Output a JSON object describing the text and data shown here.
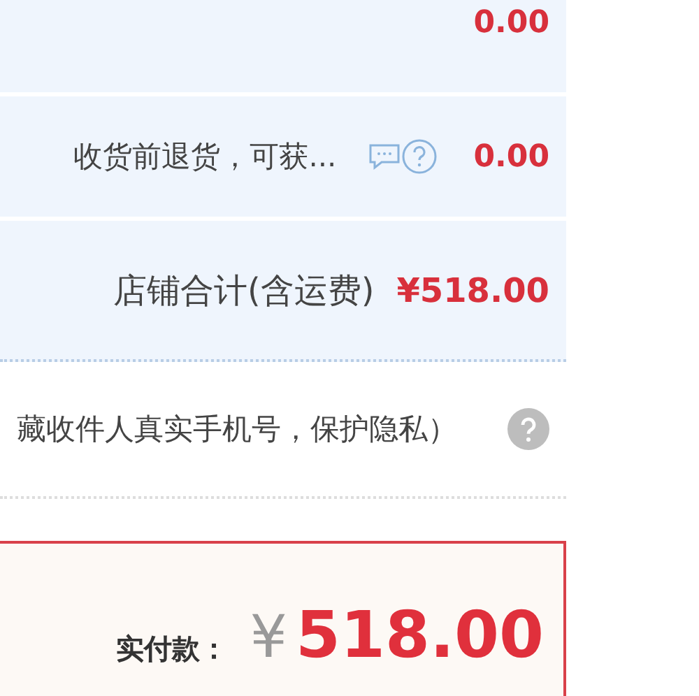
{
  "fee_rows": [
    {
      "amount": "0.00",
      "icons": false
    },
    {
      "label": "收货前退货，可获...",
      "amount": "0.00",
      "icons": true
    }
  ],
  "shop_total": {
    "label": "店铺合计(含运费)",
    "amount": "¥518.00"
  },
  "privacy": {
    "text": "藏收件人真实手机号，保护隐私）"
  },
  "payment": {
    "label": "实付款：",
    "currency": "¥",
    "amount": "518.00"
  }
}
